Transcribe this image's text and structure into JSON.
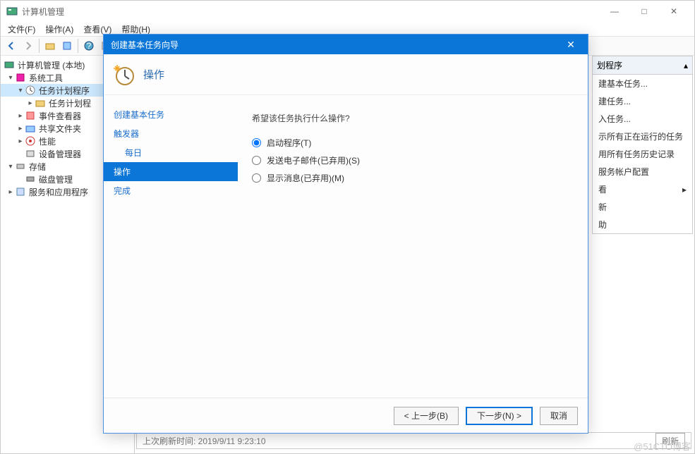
{
  "window": {
    "title": "计算机管理",
    "win_min": "—",
    "win_max": "□",
    "win_close": "✕"
  },
  "menubar": {
    "file": "文件(F)",
    "action": "操作(A)",
    "view": "查看(V)",
    "help": "帮助(H)"
  },
  "tree": {
    "root": "计算机管理 (本地)",
    "system_tools": "系统工具",
    "task_scheduler": "任务计划程序",
    "task_library": "任务计划程",
    "event_viewer": "事件查看器",
    "shared_folders": "共享文件夹",
    "performance": "性能",
    "device_manager": "设备管理器",
    "storage": "存储",
    "disk_mgmt": "磁盘管理",
    "services_apps": "服务和应用程序"
  },
  "side": {
    "header": "划程序",
    "create_basic": "建基本任务...",
    "create_task": "建任务...",
    "import_task": "入任务...",
    "show_running": "示所有正在运行的任务",
    "enable_history": "用所有任务历史记录",
    "service_account": "服务帐户配置",
    "view": "看",
    "refresh": "新",
    "help": "助"
  },
  "bottom": {
    "text": "上次刷新时间: 2019/9/11 9:23:10",
    "btn": "刷新"
  },
  "modal": {
    "title": "创建基本任务向导",
    "close": "✕",
    "header": "操作",
    "steps": {
      "create": "创建基本任务",
      "trigger": "触发器",
      "daily": "每日",
      "action": "操作",
      "finish": "完成"
    },
    "prompt": "希望该任务执行什么操作?",
    "options": {
      "start_program": "启动程序(T)",
      "send_email": "发送电子邮件(已弃用)(S)",
      "display_message": "显示消息(已弃用)(M)"
    },
    "buttons": {
      "back": "< 上一步(B)",
      "next": "下一步(N) >",
      "cancel": "取消"
    }
  },
  "watermark": "@51CTO博客"
}
